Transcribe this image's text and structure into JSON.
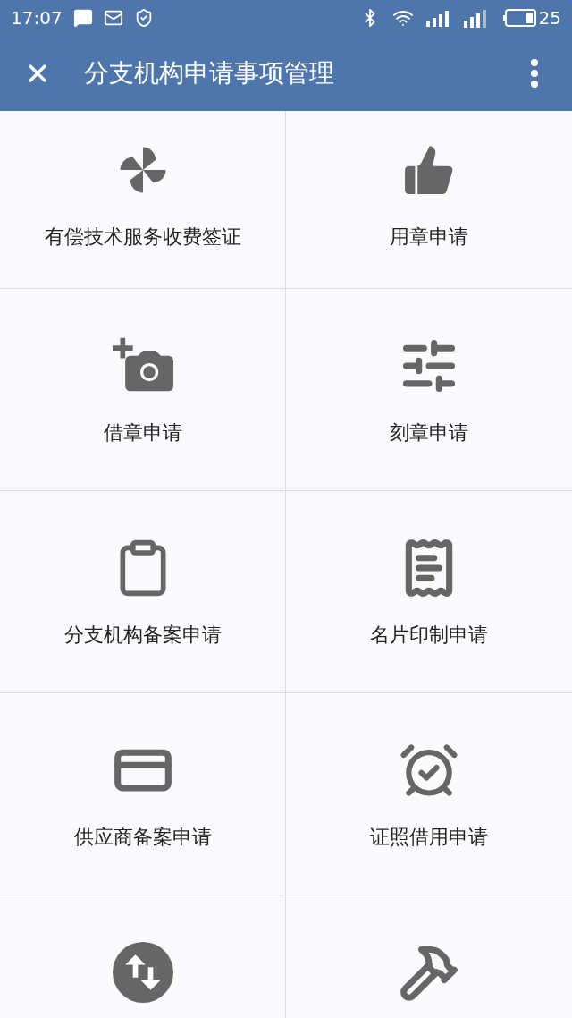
{
  "status_bar": {
    "time": "17:07",
    "battery": "25"
  },
  "toolbar": {
    "title": "分支机构申请事项管理"
  },
  "tiles": [
    {
      "kind": "pinwheel",
      "label": "有偿技术服务收费签证"
    },
    {
      "kind": "thumbs-up",
      "label": "用章申请"
    },
    {
      "kind": "camera-plus",
      "label": "借章申请"
    },
    {
      "kind": "sliders",
      "label": "刻章申请"
    },
    {
      "kind": "clipboard",
      "label": "分支机构备案申请"
    },
    {
      "kind": "receipt",
      "label": "名片印制申请"
    },
    {
      "kind": "card",
      "label": "供应商备案申请"
    },
    {
      "kind": "alarm",
      "label": "证照借用申请"
    },
    {
      "kind": "swap"
    },
    {
      "kind": "hammer"
    }
  ]
}
